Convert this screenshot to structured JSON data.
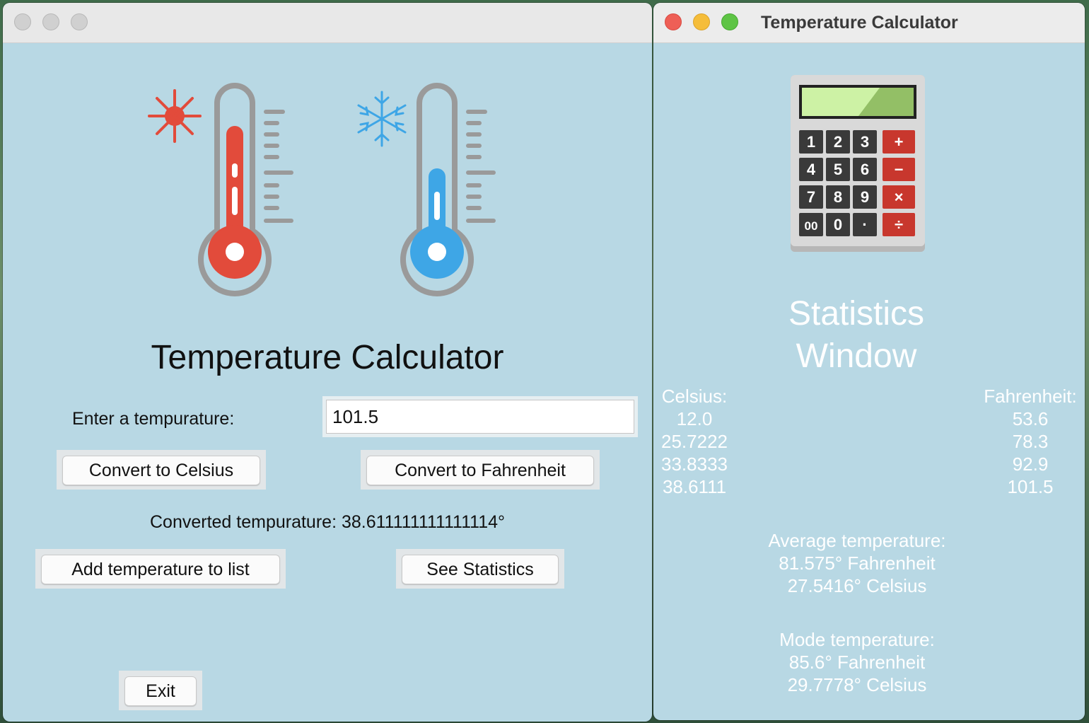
{
  "main_window": {
    "heading": "Temperature Calculator",
    "input_label": "Enter a tempurature:",
    "input_value": "101.5",
    "convert_celsius_label": "Convert to Celsius",
    "convert_fahrenheit_label": "Convert to Fahrenheit",
    "result_text": "Converted tempurature: 38.611111111111114°",
    "add_label": "Add temperature to list",
    "stats_label": "See Statistics",
    "exit_label": "Exit",
    "icons": [
      "sun-icon",
      "hot-thermometer-icon",
      "snowflake-icon",
      "cold-thermometer-icon"
    ]
  },
  "stats_window": {
    "window_title": "Temperature Calculator",
    "title_line1": "Statistics",
    "title_line2": "Window",
    "celsius_header": "Celsius:",
    "celsius_values": [
      "12.0",
      "25.7222",
      "33.8333",
      "38.6111"
    ],
    "fahrenheit_header": "Fahrenheit:",
    "fahrenheit_values": [
      "53.6",
      "78.3",
      "92.9",
      "101.5"
    ],
    "average_label": "Average temperature:",
    "average_f": "81.575° Fahrenheit",
    "average_c": "27.5416° Celsius",
    "mode_label": "Mode temperature:",
    "mode_f": "85.6° Fahrenheit",
    "mode_c": "29.7778° Celsius",
    "calculator_keys": [
      "1",
      "2",
      "3",
      "+",
      "4",
      "5",
      "6",
      "−",
      "7",
      "8",
      "9",
      "×",
      "00",
      "0",
      "·",
      "÷"
    ]
  },
  "colors": {
    "window_bg": "#b8d8e4",
    "hot_red": "#e24b3b",
    "cold_blue": "#3ea6e6",
    "thermo_grey": "#9a9a9a"
  }
}
